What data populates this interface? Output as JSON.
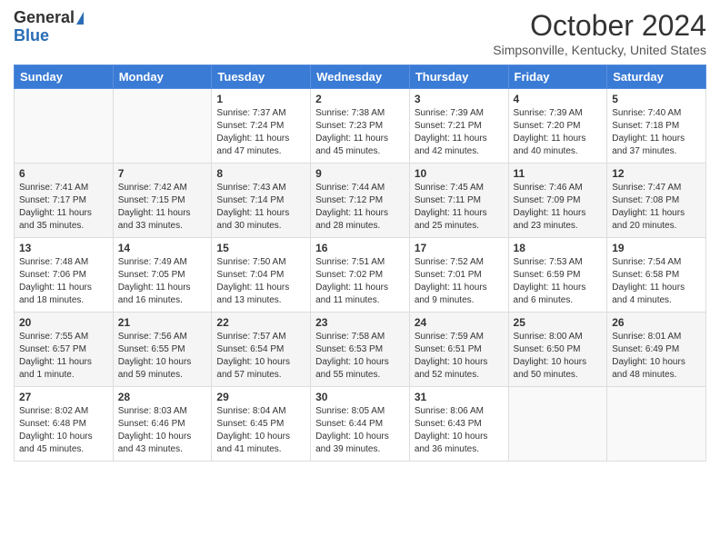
{
  "logo": {
    "general": "General",
    "blue": "Blue"
  },
  "title": "October 2024",
  "location": "Simpsonville, Kentucky, United States",
  "days_of_week": [
    "Sunday",
    "Monday",
    "Tuesday",
    "Wednesday",
    "Thursday",
    "Friday",
    "Saturday"
  ],
  "weeks": [
    [
      {
        "day": "",
        "sunrise": "",
        "sunset": "",
        "daylight": ""
      },
      {
        "day": "",
        "sunrise": "",
        "sunset": "",
        "daylight": ""
      },
      {
        "day": "1",
        "sunrise": "Sunrise: 7:37 AM",
        "sunset": "Sunset: 7:24 PM",
        "daylight": "Daylight: 11 hours and 47 minutes."
      },
      {
        "day": "2",
        "sunrise": "Sunrise: 7:38 AM",
        "sunset": "Sunset: 7:23 PM",
        "daylight": "Daylight: 11 hours and 45 minutes."
      },
      {
        "day": "3",
        "sunrise": "Sunrise: 7:39 AM",
        "sunset": "Sunset: 7:21 PM",
        "daylight": "Daylight: 11 hours and 42 minutes."
      },
      {
        "day": "4",
        "sunrise": "Sunrise: 7:39 AM",
        "sunset": "Sunset: 7:20 PM",
        "daylight": "Daylight: 11 hours and 40 minutes."
      },
      {
        "day": "5",
        "sunrise": "Sunrise: 7:40 AM",
        "sunset": "Sunset: 7:18 PM",
        "daylight": "Daylight: 11 hours and 37 minutes."
      }
    ],
    [
      {
        "day": "6",
        "sunrise": "Sunrise: 7:41 AM",
        "sunset": "Sunset: 7:17 PM",
        "daylight": "Daylight: 11 hours and 35 minutes."
      },
      {
        "day": "7",
        "sunrise": "Sunrise: 7:42 AM",
        "sunset": "Sunset: 7:15 PM",
        "daylight": "Daylight: 11 hours and 33 minutes."
      },
      {
        "day": "8",
        "sunrise": "Sunrise: 7:43 AM",
        "sunset": "Sunset: 7:14 PM",
        "daylight": "Daylight: 11 hours and 30 minutes."
      },
      {
        "day": "9",
        "sunrise": "Sunrise: 7:44 AM",
        "sunset": "Sunset: 7:12 PM",
        "daylight": "Daylight: 11 hours and 28 minutes."
      },
      {
        "day": "10",
        "sunrise": "Sunrise: 7:45 AM",
        "sunset": "Sunset: 7:11 PM",
        "daylight": "Daylight: 11 hours and 25 minutes."
      },
      {
        "day": "11",
        "sunrise": "Sunrise: 7:46 AM",
        "sunset": "Sunset: 7:09 PM",
        "daylight": "Daylight: 11 hours and 23 minutes."
      },
      {
        "day": "12",
        "sunrise": "Sunrise: 7:47 AM",
        "sunset": "Sunset: 7:08 PM",
        "daylight": "Daylight: 11 hours and 20 minutes."
      }
    ],
    [
      {
        "day": "13",
        "sunrise": "Sunrise: 7:48 AM",
        "sunset": "Sunset: 7:06 PM",
        "daylight": "Daylight: 11 hours and 18 minutes."
      },
      {
        "day": "14",
        "sunrise": "Sunrise: 7:49 AM",
        "sunset": "Sunset: 7:05 PM",
        "daylight": "Daylight: 11 hours and 16 minutes."
      },
      {
        "day": "15",
        "sunrise": "Sunrise: 7:50 AM",
        "sunset": "Sunset: 7:04 PM",
        "daylight": "Daylight: 11 hours and 13 minutes."
      },
      {
        "day": "16",
        "sunrise": "Sunrise: 7:51 AM",
        "sunset": "Sunset: 7:02 PM",
        "daylight": "Daylight: 11 hours and 11 minutes."
      },
      {
        "day": "17",
        "sunrise": "Sunrise: 7:52 AM",
        "sunset": "Sunset: 7:01 PM",
        "daylight": "Daylight: 11 hours and 9 minutes."
      },
      {
        "day": "18",
        "sunrise": "Sunrise: 7:53 AM",
        "sunset": "Sunset: 6:59 PM",
        "daylight": "Daylight: 11 hours and 6 minutes."
      },
      {
        "day": "19",
        "sunrise": "Sunrise: 7:54 AM",
        "sunset": "Sunset: 6:58 PM",
        "daylight": "Daylight: 11 hours and 4 minutes."
      }
    ],
    [
      {
        "day": "20",
        "sunrise": "Sunrise: 7:55 AM",
        "sunset": "Sunset: 6:57 PM",
        "daylight": "Daylight: 11 hours and 1 minute."
      },
      {
        "day": "21",
        "sunrise": "Sunrise: 7:56 AM",
        "sunset": "Sunset: 6:55 PM",
        "daylight": "Daylight: 10 hours and 59 minutes."
      },
      {
        "day": "22",
        "sunrise": "Sunrise: 7:57 AM",
        "sunset": "Sunset: 6:54 PM",
        "daylight": "Daylight: 10 hours and 57 minutes."
      },
      {
        "day": "23",
        "sunrise": "Sunrise: 7:58 AM",
        "sunset": "Sunset: 6:53 PM",
        "daylight": "Daylight: 10 hours and 55 minutes."
      },
      {
        "day": "24",
        "sunrise": "Sunrise: 7:59 AM",
        "sunset": "Sunset: 6:51 PM",
        "daylight": "Daylight: 10 hours and 52 minutes."
      },
      {
        "day": "25",
        "sunrise": "Sunrise: 8:00 AM",
        "sunset": "Sunset: 6:50 PM",
        "daylight": "Daylight: 10 hours and 50 minutes."
      },
      {
        "day": "26",
        "sunrise": "Sunrise: 8:01 AM",
        "sunset": "Sunset: 6:49 PM",
        "daylight": "Daylight: 10 hours and 48 minutes."
      }
    ],
    [
      {
        "day": "27",
        "sunrise": "Sunrise: 8:02 AM",
        "sunset": "Sunset: 6:48 PM",
        "daylight": "Daylight: 10 hours and 45 minutes."
      },
      {
        "day": "28",
        "sunrise": "Sunrise: 8:03 AM",
        "sunset": "Sunset: 6:46 PM",
        "daylight": "Daylight: 10 hours and 43 minutes."
      },
      {
        "day": "29",
        "sunrise": "Sunrise: 8:04 AM",
        "sunset": "Sunset: 6:45 PM",
        "daylight": "Daylight: 10 hours and 41 minutes."
      },
      {
        "day": "30",
        "sunrise": "Sunrise: 8:05 AM",
        "sunset": "Sunset: 6:44 PM",
        "daylight": "Daylight: 10 hours and 39 minutes."
      },
      {
        "day": "31",
        "sunrise": "Sunrise: 8:06 AM",
        "sunset": "Sunset: 6:43 PM",
        "daylight": "Daylight: 10 hours and 36 minutes."
      },
      {
        "day": "",
        "sunrise": "",
        "sunset": "",
        "daylight": ""
      },
      {
        "day": "",
        "sunrise": "",
        "sunset": "",
        "daylight": ""
      }
    ]
  ]
}
